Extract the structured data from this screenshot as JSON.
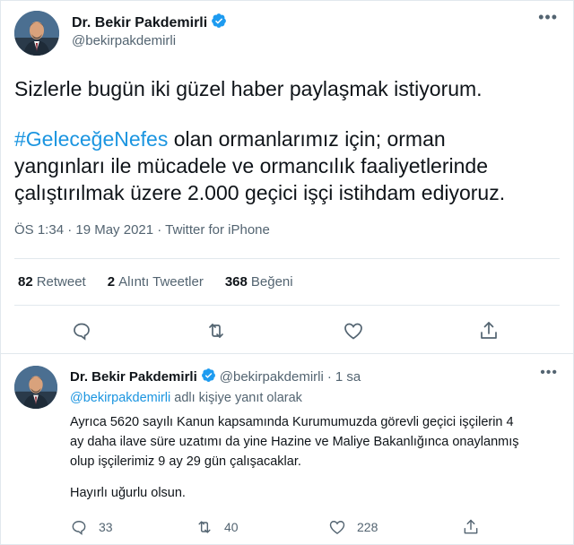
{
  "tweet": {
    "author_name": "Dr. Bekir Pakdemirli",
    "handle": "@bekirpakdemirli",
    "text_line1": "Sizlerle bugün iki güzel haber paylaşmak istiyorum.",
    "hashtag": "#GeleceğeNefes",
    "text_rest_1": " olan ormanlarımız için; orman",
    "text_rest_2": "yangınları ile mücadele ve ormancılık faaliyetlerinde",
    "text_rest_3": "çalıştırılmak üzere 2.000 geçici işçi istihdam ediyoruz.",
    "timestamp": "ÖS 1:34 · 19 May 2021 · Twitter for iPhone"
  },
  "stats": {
    "retweets_count": "82",
    "retweets_label": "Retweet",
    "quotes_count": "2",
    "quotes_label": "Alıntı Tweetler",
    "likes_count": "368",
    "likes_label": "Beğeni"
  },
  "actions": {
    "icons": [
      "reply-icon",
      "retweet-icon",
      "like-icon",
      "share-icon"
    ]
  },
  "reply": {
    "author_name": "Dr. Bekir Pakdemirli",
    "handle": "@bekirpakdemirli",
    "separator": "·",
    "time": "1 sa",
    "reply_to_mention": "@bekirpakdemirli",
    "reply_to_suffix": " adlı kişiye yanıt olarak",
    "text_line1": "Ayrıca 5620 sayılı Kanun kapsamında Kurumumuzda görevli geçici işçilerin 4",
    "text_line2": "ay daha ilave süre uzatımı da yine Hazine ve Maliye Bakanlığınca onaylanmış",
    "text_line3": "olup işçilerimiz 9 ay 29 gün çalışacaklar.",
    "text_closing": "Hayırlı uğurlu olsun.",
    "reply_count": "33",
    "retweet_count": "40",
    "like_count": "228"
  },
  "colors": {
    "accent": "#1b95e0",
    "text": "#0f1419",
    "muted": "#536471",
    "border": "#e1e8ed"
  }
}
